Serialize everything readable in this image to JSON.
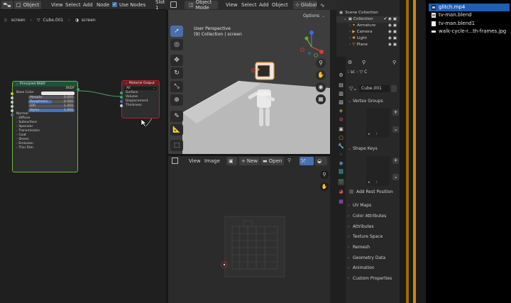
{
  "node_editor": {
    "header": {
      "editor_type": "Object",
      "menus": [
        "View",
        "Select",
        "Add",
        "Node"
      ],
      "use_nodes_label": "Use Nodes",
      "slot_label": "Slot 1"
    },
    "breadcrumb": [
      "screen",
      "Cube.001",
      "screen"
    ],
    "principled": {
      "title": "Principled BSDF",
      "output": "BSDF",
      "rows": [
        {
          "label": "Base Color",
          "value": ""
        },
        {
          "label": "Metallic",
          "value": "0.000"
        },
        {
          "label": "Roughness",
          "value": "0.500"
        },
        {
          "label": "IOR",
          "value": "1.450"
        },
        {
          "label": "Alpha",
          "value": "1.000"
        },
        {
          "label": "Normal",
          "value": ""
        }
      ],
      "panels": [
        "Diffuse",
        "Subsurface",
        "Specular",
        "Transmission",
        "Coat",
        "Sheen",
        "Emission",
        "Thin Film"
      ]
    },
    "material_output": {
      "title": "Material Output",
      "target": "All",
      "sockets": [
        "Surface",
        "Volume",
        "Displacement",
        "Thickness"
      ]
    }
  },
  "viewport": {
    "mode": "Object Mode",
    "menus": [
      "View",
      "Select",
      "Add",
      "Object"
    ],
    "transform": "Global",
    "options_label": "Options",
    "overlay_title": "User Perspective",
    "overlay_subtitle": "(9) Collection | screen"
  },
  "uv_editor": {
    "menus": [
      "View",
      "Image"
    ],
    "new_label": "New",
    "open_label": "Open"
  },
  "outliner": {
    "title": "Scene Collection",
    "collection": "Collection",
    "items": [
      "Armature",
      "Camera",
      "Light",
      "Plane"
    ]
  },
  "properties": {
    "object_name": "Cube.001",
    "sections": [
      "Vertex Groups",
      "Shape Keys",
      "Add Rest Position",
      "UV Maps",
      "Color Attributes",
      "Attributes",
      "Texture Space",
      "Remesh",
      "Geometry Data",
      "Animation",
      "Custom Properties"
    ]
  },
  "file_browser": {
    "files": [
      {
        "name": "glitch.mp4",
        "selected": true
      },
      {
        "name": "tv-man.blend",
        "selected": false
      },
      {
        "name": "tv-man.blend1",
        "selected": false
      },
      {
        "name": "walk-cycle-r...th-frames.jpg",
        "selected": false
      }
    ]
  },
  "colors": {
    "accent": "#4772b3",
    "selected_file": "#1c5fb5",
    "active_object": "#f29a2a"
  }
}
